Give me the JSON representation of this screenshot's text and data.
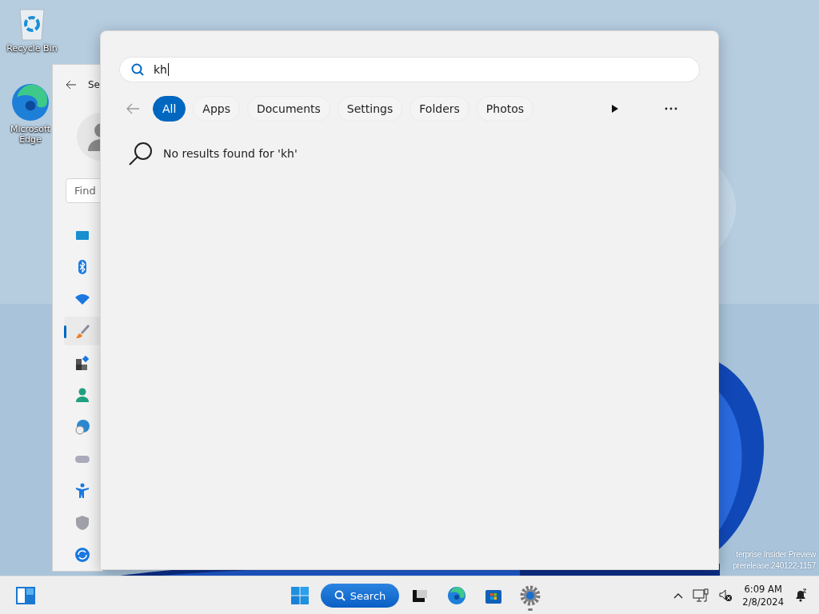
{
  "desktop_icons": [
    {
      "label": "Recycle Bin"
    },
    {
      "label": "Microsoft Edge"
    }
  ],
  "settings_window": {
    "title": "Se",
    "search_placeholder": "Find",
    "nav_items": [
      {
        "selected": false
      },
      {
        "selected": false
      },
      {
        "selected": false
      },
      {
        "selected": true
      },
      {
        "selected": false
      },
      {
        "selected": false
      },
      {
        "selected": false
      },
      {
        "selected": false
      },
      {
        "selected": false
      },
      {
        "selected": false
      },
      {
        "selected": false
      }
    ]
  },
  "search_panel": {
    "query": "kh",
    "filters": [
      {
        "label": "All",
        "selected": true
      },
      {
        "label": "Apps",
        "selected": false
      },
      {
        "label": "Documents",
        "selected": false
      },
      {
        "label": "Settings",
        "selected": false
      },
      {
        "label": "Folders",
        "selected": false
      },
      {
        "label": "Photos",
        "selected": false
      }
    ],
    "message": "No results found for 'kh'"
  },
  "watermark": [
    "terprise Insider Preview",
    "prerelease.240122-1157"
  ],
  "taskbar": {
    "search_label": "Search",
    "apps": [
      {
        "selected": false
      },
      {
        "selected": false
      },
      {
        "selected": false
      },
      {
        "selected": true
      }
    ],
    "time": "6:09 AM",
    "date": "2/8/2024"
  }
}
